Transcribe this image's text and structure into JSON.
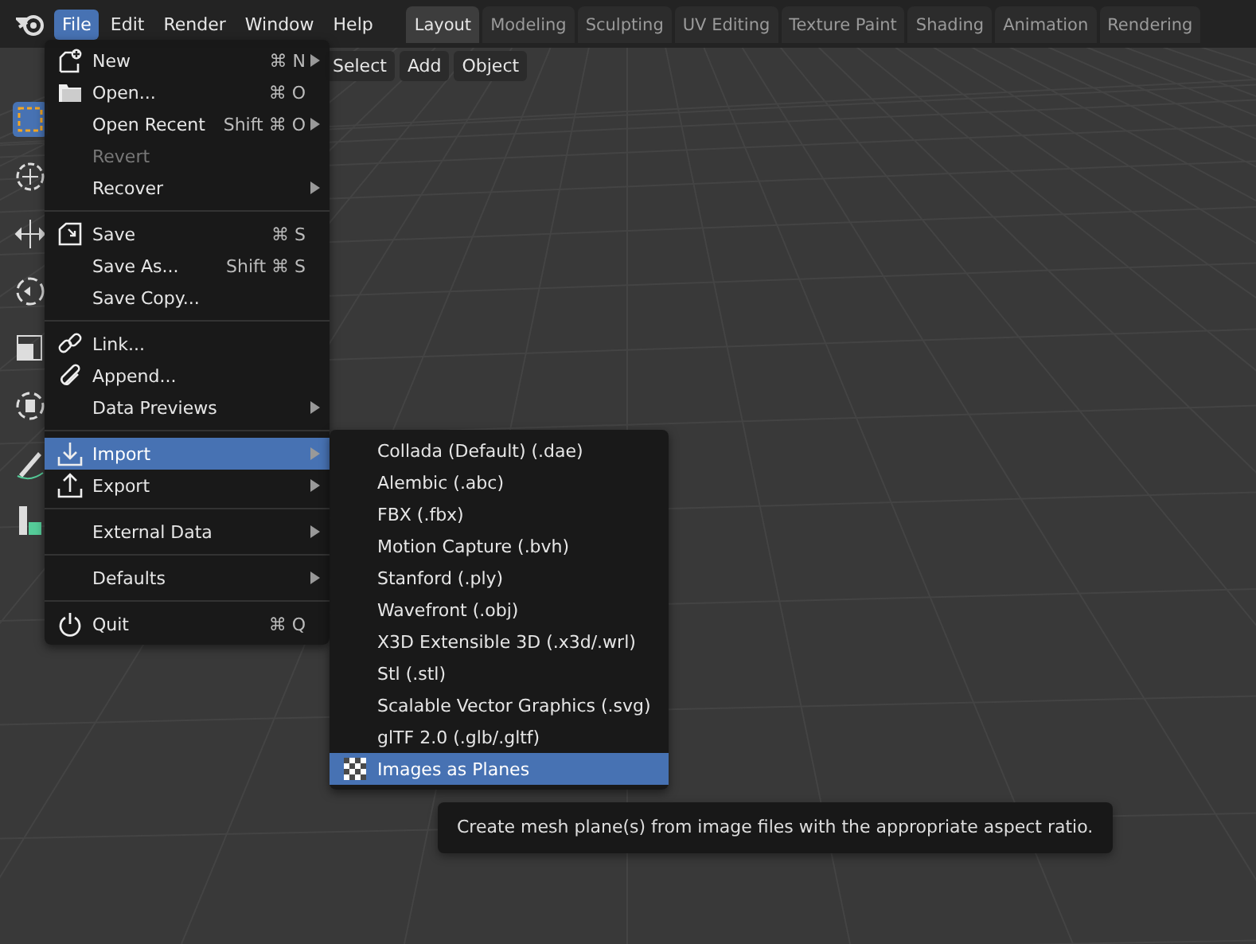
{
  "app_menu": [
    {
      "label": "File",
      "selected": true
    },
    {
      "label": "Edit",
      "selected": false
    },
    {
      "label": "Render",
      "selected": false
    },
    {
      "label": "Window",
      "selected": false
    },
    {
      "label": "Help",
      "selected": false
    }
  ],
  "workspace_tabs": [
    {
      "label": "Layout",
      "selected": true
    },
    {
      "label": "Modeling",
      "selected": false
    },
    {
      "label": "Sculpting",
      "selected": false
    },
    {
      "label": "UV Editing",
      "selected": false
    },
    {
      "label": "Texture Paint",
      "selected": false
    },
    {
      "label": "Shading",
      "selected": false
    },
    {
      "label": "Animation",
      "selected": false
    },
    {
      "label": "Rendering",
      "selected": false
    }
  ],
  "viewport_header": {
    "buttons": [
      "Select",
      "Add",
      "Object"
    ]
  },
  "file_menu": {
    "sections": [
      {
        "items": [
          {
            "label": "New",
            "shortcut": "⌘ N",
            "submenu": true,
            "disabled": false,
            "selected": false
          },
          {
            "label": "Open...",
            "shortcut": "⌘ O",
            "submenu": false,
            "disabled": false,
            "selected": false
          },
          {
            "label": "Open Recent",
            "shortcut": "Shift ⌘ O",
            "submenu": true,
            "disabled": false,
            "selected": false
          },
          {
            "label": "Revert",
            "submenu": false,
            "disabled": true,
            "selected": false
          },
          {
            "label": "Recover",
            "submenu": true,
            "disabled": false,
            "selected": false
          }
        ]
      },
      {
        "items": [
          {
            "label": "Save",
            "shortcut": "⌘ S",
            "submenu": false,
            "disabled": false,
            "selected": false
          },
          {
            "label": "Save As...",
            "shortcut": "Shift ⌘ S",
            "submenu": false,
            "disabled": false,
            "selected": false
          },
          {
            "label": "Save Copy...",
            "submenu": false,
            "disabled": false,
            "selected": false
          }
        ]
      },
      {
        "items": [
          {
            "label": "Link...",
            "submenu": false,
            "disabled": false,
            "selected": false
          },
          {
            "label": "Append...",
            "submenu": false,
            "disabled": false,
            "selected": false
          },
          {
            "label": "Data Previews",
            "submenu": true,
            "disabled": false,
            "selected": false
          }
        ]
      },
      {
        "items": [
          {
            "label": "Import",
            "submenu": true,
            "disabled": false,
            "selected": true
          },
          {
            "label": "Export",
            "submenu": true,
            "disabled": false,
            "selected": false
          }
        ]
      },
      {
        "items": [
          {
            "label": "External Data",
            "submenu": true,
            "disabled": false,
            "selected": false
          }
        ]
      },
      {
        "items": [
          {
            "label": "Defaults",
            "submenu": true,
            "disabled": false,
            "selected": false
          }
        ]
      },
      {
        "items": [
          {
            "label": "Quit",
            "shortcut": "⌘ Q",
            "submenu": false,
            "disabled": false,
            "selected": false
          }
        ]
      }
    ]
  },
  "import_menu": {
    "items": [
      {
        "label": "Collada (Default) (.dae)",
        "selected": false
      },
      {
        "label": "Alembic (.abc)",
        "selected": false
      },
      {
        "label": "FBX (.fbx)",
        "selected": false
      },
      {
        "label": "Motion Capture (.bvh)",
        "selected": false
      },
      {
        "label": "Stanford (.ply)",
        "selected": false
      },
      {
        "label": "Wavefront (.obj)",
        "selected": false
      },
      {
        "label": "X3D Extensible 3D (.x3d/.wrl)",
        "selected": false
      },
      {
        "label": "Stl (.stl)",
        "selected": false
      },
      {
        "label": "Scalable Vector Graphics (.svg)",
        "selected": false
      },
      {
        "label": "glTF 2.0 (.glb/.gltf)",
        "selected": false
      },
      {
        "label": "Images as Planes",
        "selected": true
      }
    ]
  },
  "tooltip": {
    "text": "Create mesh plane(s) from image files with the appropriate aspect ratio."
  }
}
